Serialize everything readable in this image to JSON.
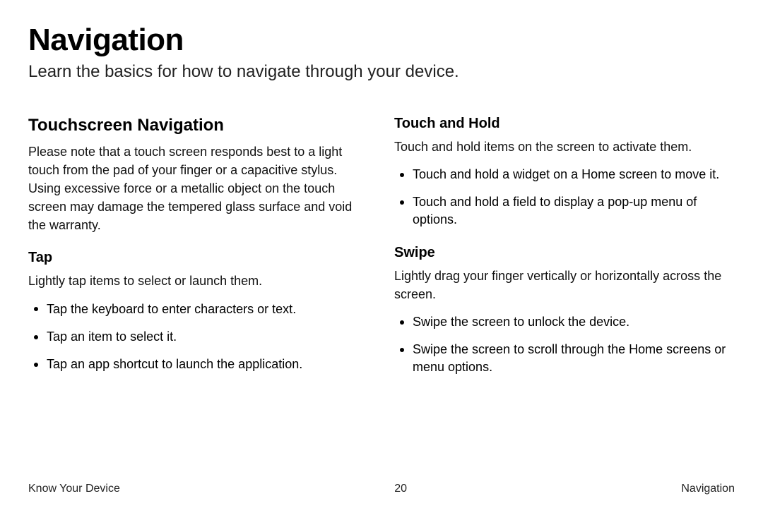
{
  "title": "Navigation",
  "subtitle": "Learn the basics for how to navigate through your device.",
  "left": {
    "heading": "Touchscreen Navigation",
    "intro": "Please note that a touch screen responds best to a light touch from the pad of your finger or a capacitive stylus. Using excessive force or a metallic object on the touch screen may damage the tempered glass surface and void the warranty.",
    "tap": {
      "heading": "Tap",
      "intro": "Lightly tap items to select or launch them.",
      "items": [
        "Tap the keyboard to enter characters or text.",
        "Tap an item to select it.",
        "Tap an app shortcut to launch the application."
      ]
    }
  },
  "right": {
    "touchhold": {
      "heading": "Touch and Hold",
      "intro": "Touch and hold items on the screen to activate them.",
      "items": [
        "Touch and hold a widget on a Home screen to move it.",
        "Touch and hold a field to display a pop-up menu of options."
      ]
    },
    "swipe": {
      "heading": "Swipe",
      "intro": "Lightly drag your finger vertically or horizontally across the screen.",
      "items": [
        "Swipe the screen to unlock the device.",
        "Swipe the screen to scroll through the Home screens or menu options."
      ]
    }
  },
  "footer": {
    "left": "Know Your Device",
    "center": "20",
    "right": "Navigation"
  }
}
